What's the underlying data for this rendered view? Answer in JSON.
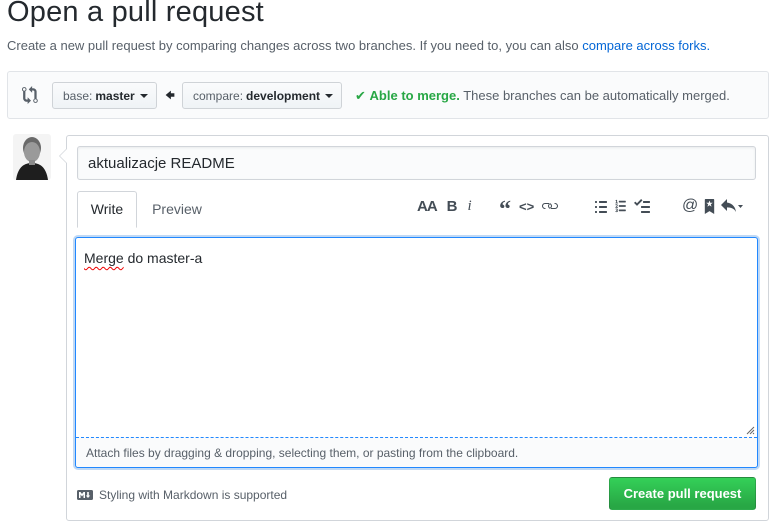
{
  "page": {
    "title": "Open a pull request",
    "subtitle_text": "Create a new pull request by comparing changes across two branches. If you need to, you can also ",
    "subtitle_link": "compare across forks."
  },
  "range": {
    "base_label": "base:",
    "base_branch": "master",
    "compare_label": "compare:",
    "compare_branch": "development",
    "merge_ok": "Able to merge.",
    "merge_text": " These branches can be automatically merged."
  },
  "form": {
    "title_value": "aktualizacje README",
    "tabs": {
      "write": "Write",
      "preview": "Preview"
    },
    "toolbar": {
      "header": "AA",
      "bold": "B",
      "italic": "i",
      "quote": "“",
      "code": "<>"
    },
    "body_first_word": "Merge",
    "body_rest": " do master-a",
    "attach_text": "Attach files by dragging & dropping, selecting them, or pasting from the clipboard.",
    "markdown_note": "Styling with Markdown is supported",
    "submit_label": "Create pull request"
  },
  "colors": {
    "accent": "#0366d6",
    "success": "#28a745",
    "focus": "#2188ff"
  },
  "icons": [
    "compare-icon",
    "arrow-left-icon",
    "check-icon",
    "avatar",
    "quote-icon",
    "code-icon",
    "link-icon",
    "unordered-list-icon",
    "ordered-list-icon",
    "task-list-icon",
    "mention-icon",
    "bookmark-icon",
    "reply-icon",
    "markdown-icon"
  ]
}
